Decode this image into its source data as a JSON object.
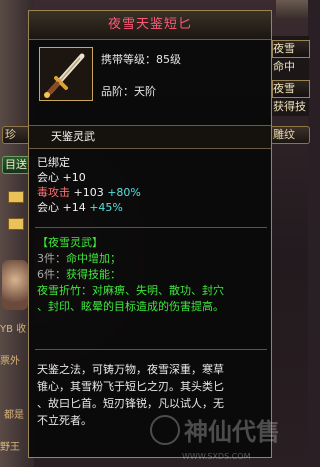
{
  "background": {
    "left_tags": [
      "珍",
      "目",
      "YB 收",
      "票外",
      "都是",
      "野王"
    ],
    "left_tabs": [
      "珍",
      "目送"
    ],
    "right_tabs": [
      "夜雪",
      "命中",
      "夜雪",
      "获得技",
      "雕纹"
    ]
  },
  "tooltip": {
    "title": "夜雪天鉴短匕",
    "icon_name": "dagger-icon",
    "carry_level": "携带等级：85级",
    "quality": "品阶：天阶",
    "section_header": "天鉴灵武",
    "bound": "已绑定",
    "stats": [
      {
        "label": "会心",
        "base": "+10",
        "extra": ""
      },
      {
        "label": "毒攻击",
        "base": "+103",
        "extra": "+80%"
      },
      {
        "label": "会心",
        "base": "+14",
        "extra": "+45%"
      }
    ],
    "set": {
      "name": "【夜雪灵武】",
      "piece3_label": "3件：",
      "piece3_value": "命中增加；",
      "piece6_label": "6件：",
      "piece6_value": "获得技能：",
      "skill_line1": "夜雪折竹：对麻痹、失明、散功、封穴",
      "skill_line2": "、封印、眩晕的目标造成的伤害提高。"
    },
    "description_lines": [
      "天鉴之法，可铸万物，夜雪深重，寒草",
      "锥心，其雪粉飞于短匕之刃。其头类匕",
      "、故曰匕首。短刃锋锐，凡以试人，无",
      "不立死者。"
    ]
  },
  "watermark": {
    "text": "神仙代售",
    "url": "WWW.SXDS.COM"
  }
}
